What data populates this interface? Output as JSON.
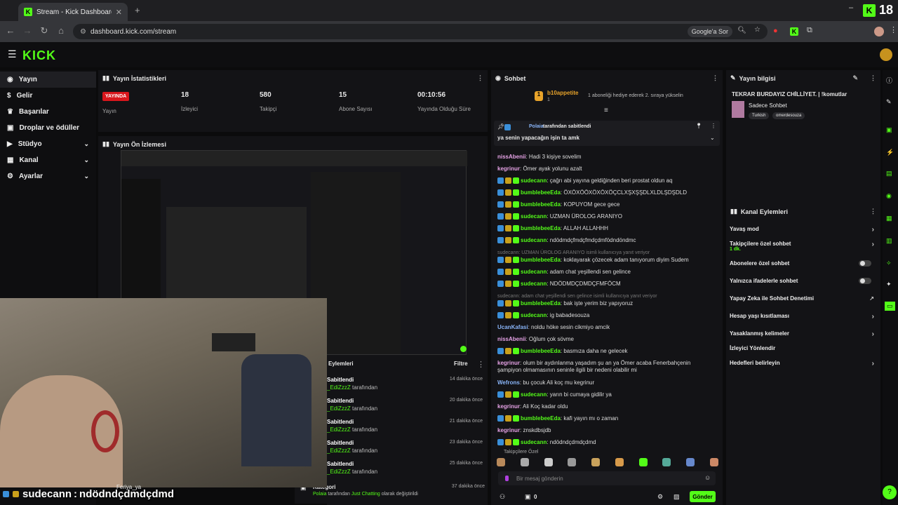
{
  "browser": {
    "tab_title": "Stream - Kick Dashboard",
    "url": "dashboard.kick.com/stream",
    "google_button": "Google'a Sor",
    "corner_text": "18"
  },
  "app": {
    "logo": "KICK"
  },
  "sidebar": {
    "items": [
      {
        "label": "Yayın",
        "icon": "broadcast-icon"
      },
      {
        "label": "Gelir",
        "icon": "dollar-icon"
      },
      {
        "label": "Başarılar",
        "icon": "trophy-icon"
      },
      {
        "label": "Droplar ve ödüller",
        "icon": "gift-icon"
      },
      {
        "label": "Stüdyo",
        "icon": "camera-icon"
      },
      {
        "label": "Kanal",
        "icon": "channel-icon"
      },
      {
        "label": "Ayarlar",
        "icon": "gear-icon"
      }
    ]
  },
  "stats": {
    "title": "Yayın İstatistikleri",
    "live_badge": "YAYINDA",
    "live_label": "Yayın",
    "viewers": "18",
    "viewers_label": "İzleyici",
    "followers": "580",
    "followers_label": "Takipçi",
    "subs": "15",
    "subs_label": "Abone Sayısı",
    "uptime": "00:10:56",
    "uptime_label": "Yayında Olduğu Süre"
  },
  "preview": {
    "title": "Yayın Ön İzlemesi"
  },
  "events": {
    "title": "Eylemleri",
    "filter": "Filtre",
    "items": [
      {
        "action": "Sabitlendi",
        "user": "_EdiZzzZ",
        "suffix": "tarafından",
        "time": "14 dakika önce"
      },
      {
        "action": "Sabitlendi",
        "user": "_EdiZzzZ",
        "suffix": "tarafından",
        "time": "20 dakika önce"
      },
      {
        "action": "Sabitlendi",
        "user": "_EdiZzzZ",
        "suffix": "tarafından",
        "time": "21 dakika önce"
      },
      {
        "action": "Sabitlendi",
        "user": "_EdiZzzZ",
        "suffix": "tarafından",
        "time": "23 dakika önce"
      },
      {
        "action": "Sabitlendi",
        "user": "_EdiZzzZ",
        "suffix": "tarafından",
        "time": "25 dakika önce"
      }
    ],
    "category_title": "Kategori",
    "category_user": "Polaia",
    "category_mid": "tarafından",
    "category_name": "Just Chatting",
    "category_end": "olarak değiştirildi",
    "category_time": "37 dakika önce",
    "follow_text": "Feriya_ya",
    "follow_time": "2 saat önce"
  },
  "overlay": {
    "user": "sudecann",
    "sep": ":",
    "text": "ndödndçdmdçdmd"
  },
  "chat": {
    "title": "Sohbet",
    "gift_user": "b10appetite",
    "gift_text": "1 aboneliği hediye ederek 2. sıraya yükselin",
    "gift_count": "1",
    "pinned_by": "Polaia",
    "pinned_suffix": "tarafından sabitlendi",
    "pinned_text": "ya senin yapacağın işin ta amk",
    "messages": [
      {
        "user": "nissAbenii",
        "text": "Hadi 3 kişiye sovelim",
        "c": "p"
      },
      {
        "user": "kegrinur",
        "text": "Ömer ayak yolunu azalt",
        "c": "p"
      },
      {
        "user": "sudecann",
        "text": "çağrı abi yayına geldiğinden beri prostat oldun aq",
        "c": "g"
      },
      {
        "user": "bumblebeeEda",
        "text": "ÖXÖXÖÖXÖXÖXÖÇCLXŞXŞŞDLXLDLŞDŞDLD",
        "c": "g"
      },
      {
        "user": "bumblebeeEda",
        "text": "KOPUYOM gece gece",
        "c": "g"
      },
      {
        "user": "sudecann",
        "text": "UZMAN ÜROLOG ARANIYO",
        "c": "g"
      },
      {
        "user": "bumblebeeEda",
        "text": "ALLAH ALLAHHH",
        "c": "g"
      },
      {
        "user": "sudecann",
        "text": "ndödmdçfmdçfmdçdmfödndöndmc",
        "c": "g"
      },
      {
        "user": "",
        "text": "sudecann: UZMAN ÜROLOG ARANIYO isimli kullanıcıya yanıt veriyor",
        "c": "s"
      },
      {
        "user": "bumblebeeEda",
        "text": "koklayarak çözecek adam tanıyorum diyim Sudem",
        "c": "g"
      },
      {
        "user": "sudecann",
        "text": "adam chat yeşillendi sen gelince",
        "c": "g"
      },
      {
        "user": "sudecann",
        "text": "NDÖDMDÇDMDÇFMFÖCM",
        "c": "g"
      },
      {
        "user": "",
        "text": "sudecann: adam chat yeşillendi sen gelince isimli kullanıcıya yanıt veriyor",
        "c": "s"
      },
      {
        "user": "bumblebeeEda",
        "text": "bak işte yerim biz yapıyoruz",
        "c": "g"
      },
      {
        "user": "sudecann",
        "text": "ig babadesouza",
        "c": "g"
      },
      {
        "user": "UcanKafasi",
        "text": "noldu höke sesin cikmiyo amcik",
        "c": "b"
      },
      {
        "user": "nissAbenii",
        "text": "Oğlum çok sövme",
        "c": "p"
      },
      {
        "user": "bumblebeeEda",
        "text": "basmıza daha ne gelecek",
        "c": "g"
      },
      {
        "user": "kegrinur",
        "text": "olum bir aydınlanma yaşadım şu an ya Ömer acaba Fenerbahçenin şampiyon olmamasının seninle ilgili bir nedeni olabilir mi",
        "c": "p"
      },
      {
        "user": "Wefrons",
        "text": "bu çocuk Ali koç mu kegrinur",
        "c": "b"
      },
      {
        "user": "sudecann",
        "text": "yarın bi cumaya gidilir ya",
        "c": "g"
      },
      {
        "user": "kegrinur",
        "text": "Ali Koç kadar oldu",
        "c": "p"
      },
      {
        "user": "bumblebeeEda",
        "text": "kafi yayın mı o zaman",
        "c": "g"
      },
      {
        "user": "kegrinur",
        "text": "znskdbsjdb",
        "c": "p"
      },
      {
        "user": "sudecann",
        "text": "ndödndçdmdçdmd",
        "c": "g"
      }
    ],
    "followers_only": "Takipçilere Özel",
    "placeholder": "Bir mesaj gönderin",
    "send": "Gönder",
    "count": "0"
  },
  "info": {
    "title": "Yayın bilgisi",
    "stream_title": "TEKRAR BURDAYIZ CHİLLİYET. | !komutlar",
    "channel": "Sadece Sohbet",
    "tags": [
      "Turkish",
      "omerdesouza"
    ]
  },
  "actions": {
    "title": "Kanal Eylemleri",
    "items": [
      {
        "label": "Yavaş mod",
        "sub": "",
        "kind": "chev"
      },
      {
        "label": "Takipçilere özel sohbet",
        "sub": "1 dk.",
        "kind": "chev"
      },
      {
        "label": "Abonelere özel sohbet",
        "sub": "",
        "kind": "toggle"
      },
      {
        "label": "Yalnızca ifadelerle sohbet",
        "sub": "",
        "kind": "toggle"
      },
      {
        "label": "Yapay Zeka ile Sohbet Denetimi",
        "sub": "",
        "kind": "link"
      },
      {
        "label": "Hesap yaşı kısıtlaması",
        "sub": "",
        "kind": "chev"
      },
      {
        "label": "Yasaklanmış kelimeler",
        "sub": "",
        "kind": "chev"
      },
      {
        "label": "İzleyici Yönlendir",
        "sub": "",
        "kind": "none"
      },
      {
        "label": "Hedefleri belirleyin",
        "sub": "",
        "kind": "chev"
      }
    ]
  },
  "colors": {
    "accent": "#53fc18",
    "live": "#d9161c",
    "bg": "#0b0b0c",
    "panel": "#131316"
  }
}
